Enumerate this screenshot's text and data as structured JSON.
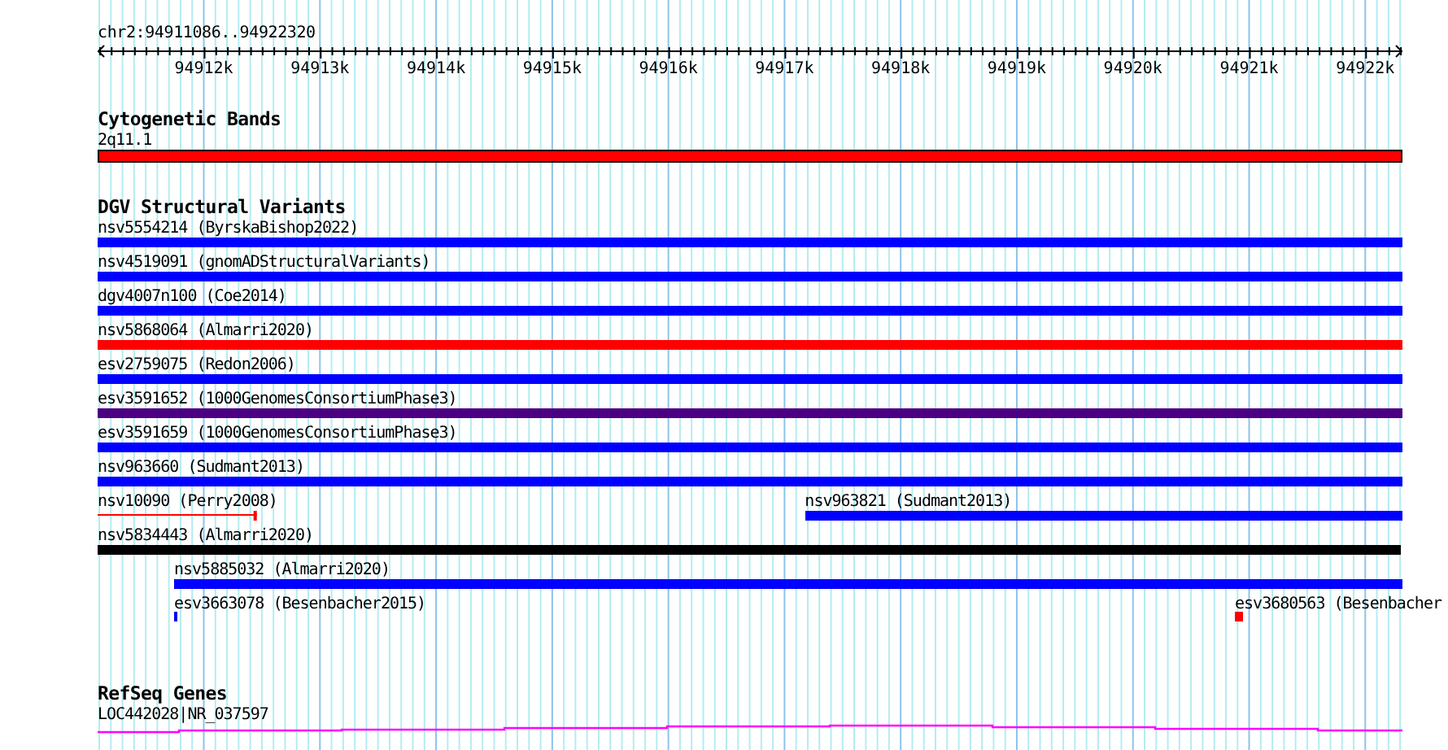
{
  "ruler": {
    "location": "chr2:94911086..94922320",
    "ticks": [
      "94912k",
      "94913k",
      "94914k",
      "94915k",
      "94916k",
      "94917k",
      "94918k",
      "94919k",
      "94920k",
      "94921k",
      "94922k"
    ]
  },
  "tracks": [
    {
      "title": "Cytogenetic Bands",
      "kind": "bands",
      "rows": [
        [
          {
            "label": "2q11.1",
            "kind": "bar",
            "color": "#ff0000"
          }
        ]
      ]
    },
    {
      "title": "DGV Structural Variants",
      "kind": "features",
      "rows": [
        [
          {
            "label": "nsv5554214 (ByrskaBishop2022)",
            "kind": "bar",
            "color": "#0000ff"
          }
        ],
        [
          {
            "label": "nsv4519091 (gnomADStructuralVariants)",
            "kind": "bar",
            "color": "#0000ff"
          }
        ],
        [
          {
            "label": "dgv4007n100 (Coe2014)",
            "kind": "bar",
            "color": "#0000ff"
          }
        ],
        [
          {
            "label": "nsv5868064 (Almarri2020)",
            "kind": "bar",
            "color": "#ff0000"
          }
        ],
        [
          {
            "label": "esv2759075 (Redon2006)",
            "kind": "bar",
            "color": "#0000ff"
          }
        ],
        [
          {
            "label": "esv3591652 (1000GenomesConsortiumPhase3)",
            "kind": "bar",
            "color": "#4b0082"
          }
        ],
        [
          {
            "label": "esv3591659 (1000GenomesConsortiumPhase3)",
            "kind": "bar",
            "color": "#0000ff"
          }
        ],
        [
          {
            "label": "nsv963660 (Sudmant2013)",
            "kind": "bar",
            "color": "#0000ff"
          }
        ],
        [
          {
            "label": "nsv10090 (Perry2008)",
            "kind": "line",
            "color": "#ff0000"
          },
          {
            "label": "nsv963821 (Sudmant2013)",
            "kind": "bar",
            "color": "#0000ff"
          }
        ],
        [
          {
            "label": "nsv5834443 (Almarri2020)",
            "kind": "bar",
            "color": "#000000"
          }
        ],
        [
          {
            "label": "nsv5885032 (Almarri2020)",
            "kind": "bar",
            "color": "#0000ff"
          }
        ],
        [
          {
            "label": "esv3663078 (Besenbacher2015)",
            "kind": "mark",
            "color": "#0000ff"
          },
          {
            "label": "esv3680563 (Besenbacher",
            "kind": "mark",
            "color": "#ff0000"
          }
        ]
      ]
    },
    {
      "title": "RefSeq Genes",
      "kind": "gene",
      "rows": [
        [
          {
            "label": "LOC442028|NR_037597",
            "kind": "gene",
            "color": "#ff00ff"
          }
        ]
      ]
    }
  ]
}
